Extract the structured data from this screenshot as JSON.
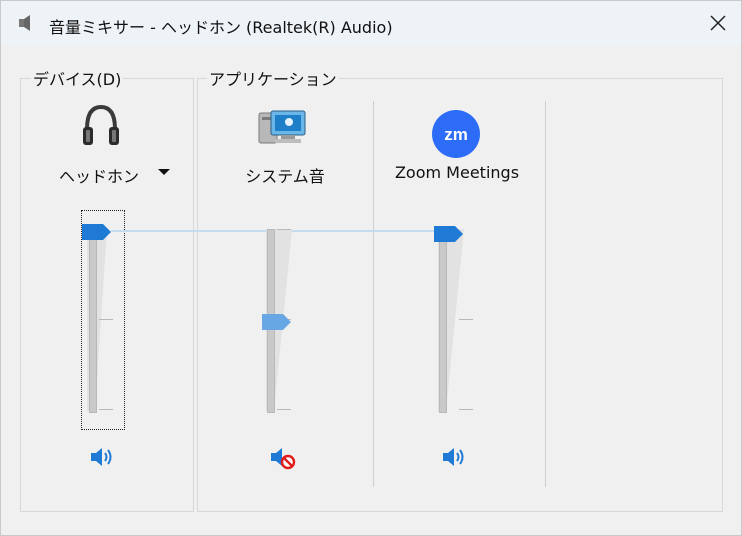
{
  "window": {
    "title": "音量ミキサー - ヘッドホン (Realtek(R) Audio)",
    "close_label": "✕"
  },
  "device_group": {
    "label": "デバイス(D)",
    "device_name": "ヘッドホン",
    "volume_percent": 100
  },
  "apps_group": {
    "label": "アプリケーション",
    "apps": [
      {
        "name": "システム音",
        "volume_percent": 50,
        "muted": true
      },
      {
        "name": "Zoom Meetings",
        "volume_percent": 100,
        "muted": false
      }
    ]
  },
  "colors": {
    "accent": "#1e7ad4",
    "accent_light": "#67a8e4",
    "mute_red": "#e21b1b",
    "zoom_blue": "#2d6cf6"
  },
  "icons": {
    "title": "speaker-icon",
    "device": "headphones-icon",
    "system_sounds": "system-sounds-icon",
    "zoom": "zoom-app-icon",
    "speaker": "speaker-on-icon",
    "speaker_muted": "speaker-muted-icon"
  }
}
